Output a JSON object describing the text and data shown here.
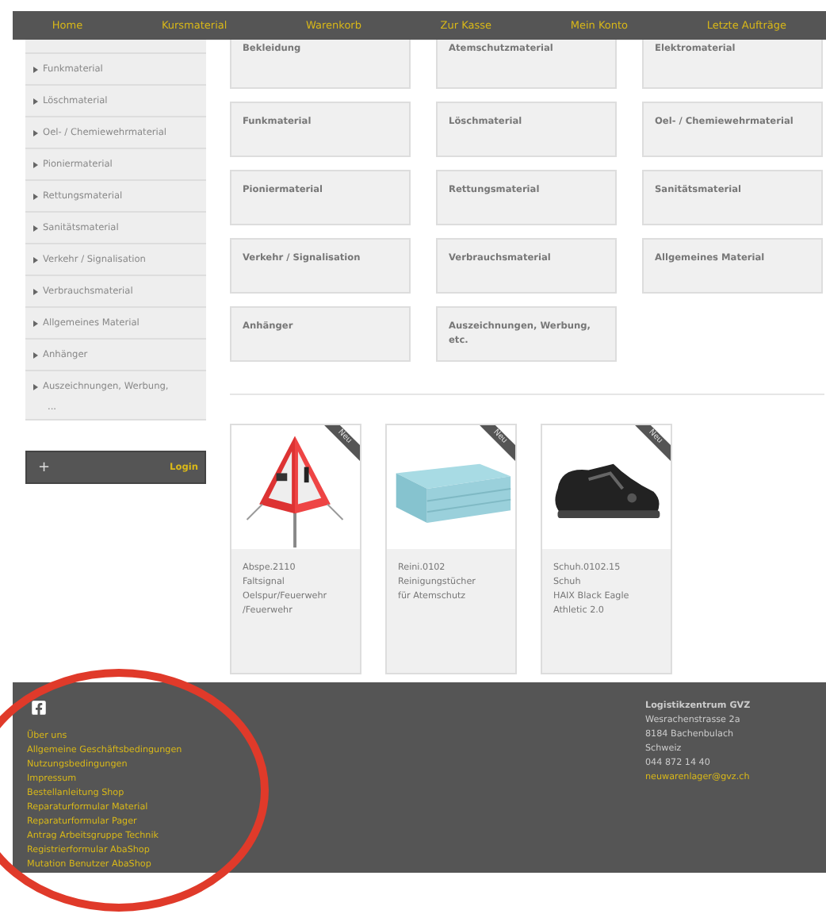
{
  "nav": [
    {
      "label": "Home"
    },
    {
      "label": "Kursmaterial"
    },
    {
      "label": "Warenkorb"
    },
    {
      "label": "Zur Kasse"
    },
    {
      "label": "Mein Konto"
    },
    {
      "label": "Letzte Aufträge"
    }
  ],
  "sidebar": {
    "items": [
      {
        "label": "Funkmaterial"
      },
      {
        "label": "Löschmaterial"
      },
      {
        "label": "Oel- / Chemiewehrmaterial"
      },
      {
        "label": "Pioniermaterial"
      },
      {
        "label": "Rettungsmaterial"
      },
      {
        "label": "Sanitätsmaterial"
      },
      {
        "label": "Verkehr / Signalisation"
      },
      {
        "label": "Verbrauchsmaterial"
      },
      {
        "label": "Allgemeines Material"
      },
      {
        "label": "Anhänger"
      },
      {
        "label": "Auszeichnungen, Werbung,",
        "more": "..."
      }
    ],
    "login": {
      "plus": "+",
      "label": "Login"
    }
  },
  "categories": [
    "Bekleidung",
    "Atemschutzmaterial",
    "Elektromaterial",
    "Funkmaterial",
    "Löschmaterial",
    "Oel- / Chemiewehrmaterial",
    "Pioniermaterial",
    "Rettungsmaterial",
    "Sanitätsmaterial",
    "Verkehr / Signalisation",
    "Verbrauchsmaterial",
    "Allgemeines Material",
    "Anhänger",
    "Auszeichnungen, Werbung, etc."
  ],
  "products": [
    {
      "kind": "sign",
      "badge": "Neu",
      "code": "Abspe.2110",
      "lines": [
        "Faltsignal",
        "Oelspur/Feuerwehr",
        "/Feuerwehr"
      ]
    },
    {
      "kind": "pads",
      "badge": "Neu",
      "code": "Reini.0102",
      "lines": [
        "Reinigungstücher",
        "für Atemschutz"
      ]
    },
    {
      "kind": "shoe",
      "badge": "Neu",
      "code": "Schuh.0102.15",
      "lines": [
        "Schuh",
        "HAIX Black Eagle",
        "Athletic 2.0"
      ]
    }
  ],
  "footer": {
    "links": [
      "Über uns",
      "Allgemeine Geschäftsbedingungen",
      "Nutzungsbedingungen",
      "Impressum",
      "Bestellanleitung Shop",
      "Reparaturformular Material",
      "Reparaturformular Pager",
      "Antrag Arbeitsgruppe Technik",
      "Registrierformular AbaShop",
      "Mutation Benutzer AbaShop"
    ],
    "address": {
      "name": "Logistikzentrum GVZ",
      "lines": [
        "Wesrachenstrasse 2a",
        "8184 Bachenbulach",
        "Schweiz",
        "044 872 14 40"
      ],
      "email": "neuwarenlager@gvz.ch"
    }
  }
}
